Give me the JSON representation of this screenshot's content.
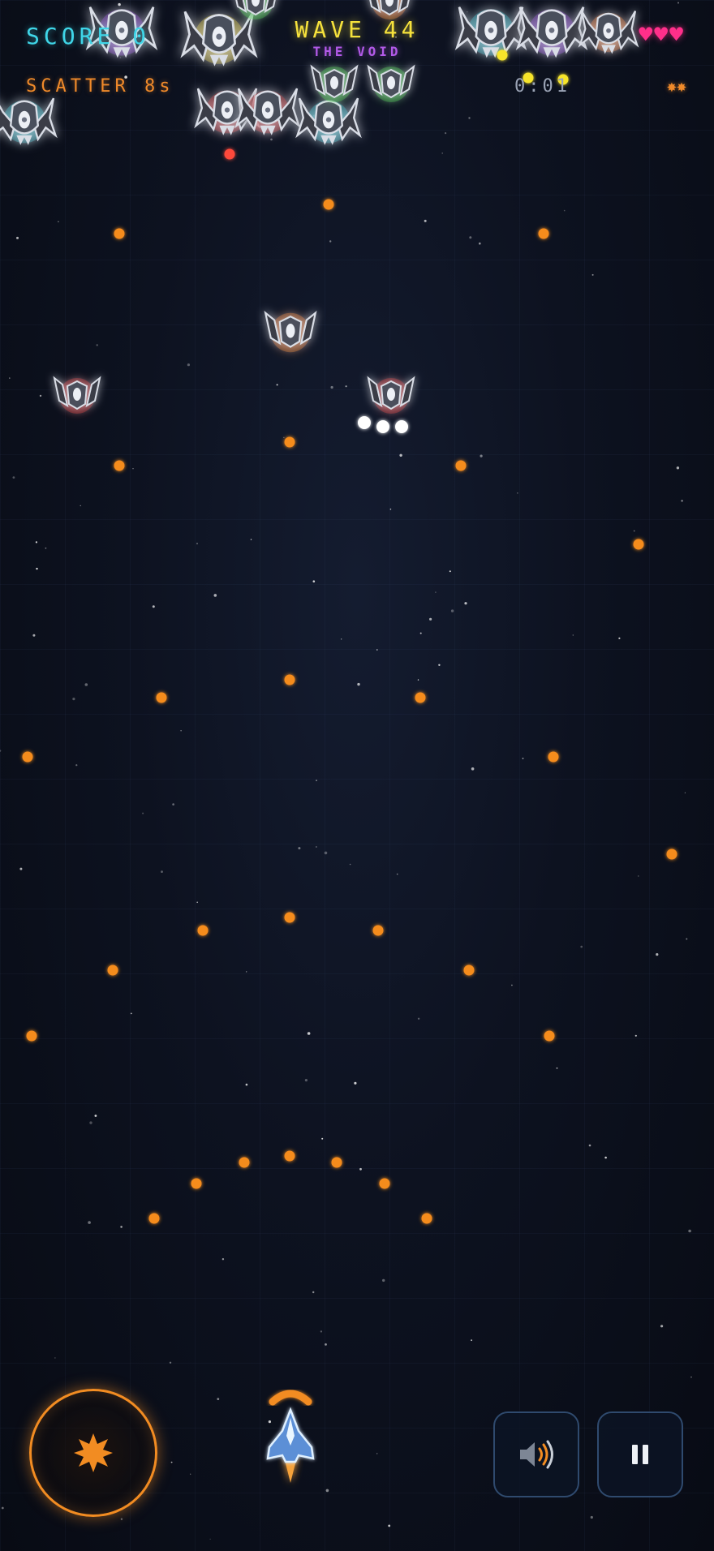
{
  "hud": {
    "score_label": "SCORE",
    "score_value": "0",
    "wave_label": "WAVE 44",
    "wave_name": "THE VOID",
    "lives": "♥♥♥",
    "powerup_status": "SCATTER 8s",
    "timer": "0:01",
    "bombs": "✸✸"
  },
  "colors": {
    "score": "#3fd6e8",
    "wave": "#f6e23c",
    "wave_name": "#b25ae8",
    "lives": "#ff2f8a",
    "accent_orange": "#f28c22",
    "player_bullet": "#f58c1e",
    "enemy_bullet_white": "#ffffff",
    "enemy_bullet_red": "#ff4a3a",
    "enemy_bullet_yellow": "#f7e52c",
    "glow_cyan": "#27c9d6",
    "glow_red": "#e0332f",
    "glow_green": "#48d04a",
    "glow_yellow": "#e6d22a",
    "glow_purple": "#a04ae0",
    "glow_orange": "#f08c22"
  },
  "controls": {
    "bomb_button_icon": "starburst-icon",
    "sound_button_icon": "speaker-icon",
    "pause_button_icon": "pause-icon"
  },
  "player": {
    "ship": "player-ship-icon",
    "shield": "shield-arc"
  }
}
